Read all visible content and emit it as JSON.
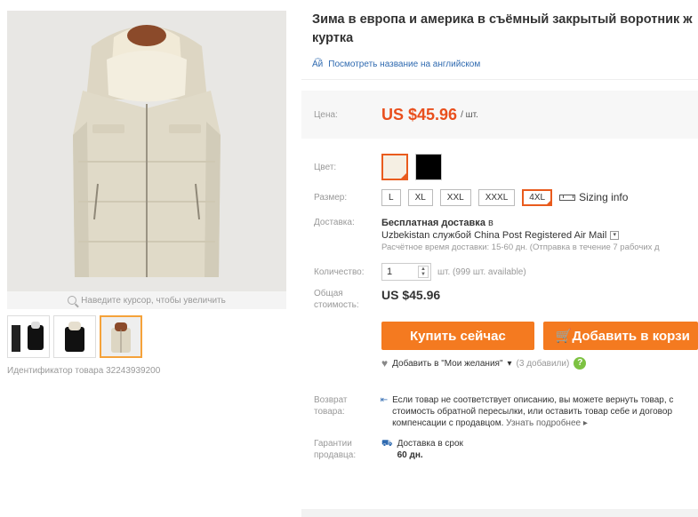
{
  "gallery": {
    "zoom_hint": "Наведите курсор, чтобы увеличить",
    "product_id": "Идентификатор товара 32243939200"
  },
  "product": {
    "title_line1": "Зима в европа и америка в съёмный закрытый воротник ж",
    "title_line2": "куртка",
    "translate_link": "Посмотреть название на английском"
  },
  "price": {
    "label": "Цена:",
    "value": "US $45.96",
    "unit": "/ шт."
  },
  "color": {
    "label": "Цвет:",
    "options": [
      "cream",
      "black"
    ],
    "selected": "cream",
    "accent": "#e95b1d"
  },
  "size": {
    "label": "Размер:",
    "options": [
      "L",
      "XL",
      "XXL",
      "XXXL",
      "4XL"
    ],
    "selected": "4XL",
    "sizing_info": "Sizing info"
  },
  "shipping": {
    "label": "Доставка:",
    "title": "Бесплатная доставка",
    "title_suffix": " в",
    "line2": "Uzbekistan службой China Post Registered Air Mail",
    "line3": "Расчётное время доставки: 15-60 дн. (Отправка в течение 7 рабочих д"
  },
  "quantity": {
    "label": "Количество:",
    "value": "1",
    "note": "шт. (999 шт. available)"
  },
  "total": {
    "label": "Общая стоимость:",
    "value": "US $45.96"
  },
  "buttons": {
    "buy_now": "Купить сейчас",
    "add_to_cart": "Добавить в корзи"
  },
  "wishlist": {
    "label": "Добавить в \"Мои желания\"",
    "count": "(3 добавили)"
  },
  "returns": {
    "label": "Возврат товара:",
    "line1": "Если товар не соответствует описанию, вы можете вернуть товар, с",
    "line2": "стоимость обратной пересылки, или оставить товар себе и договор",
    "line3": "компенсации с продавцом.",
    "more": "Узнать подробнее"
  },
  "guarantee": {
    "label": "Гарантии продавца:",
    "line1": "Доставка в срок",
    "line2": "60 дн."
  },
  "colors": {
    "price": "#e94f1d",
    "button": "#f47a20",
    "link": "#2f6ab0"
  }
}
